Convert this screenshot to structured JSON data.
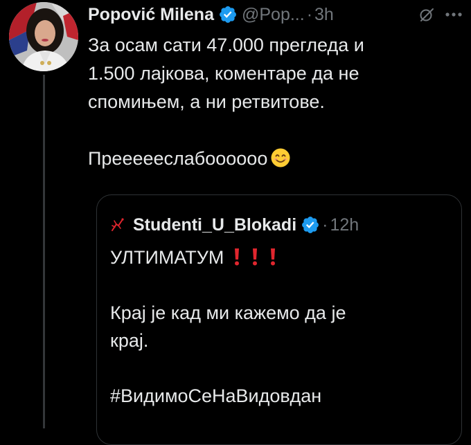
{
  "tweet": {
    "author": {
      "display_name": "Popović Milena",
      "handle": "@Pop...",
      "verified": true
    },
    "separator": "·",
    "time": "3h",
    "text_lines": [
      "За осам сати 47.000 прегледа и",
      "1.500 лајкова, коментаре да не",
      "спомињем, а ни ретвитове."
    ],
    "text_line2": "Прееееeслабоооооо",
    "emoji": "smiling-face-icon",
    "icons": {
      "verified": "verified-badge-icon",
      "grok": "grok-icon",
      "more": "more-icon"
    }
  },
  "quote": {
    "author": {
      "display_name": "Studenti_U_Blokadi",
      "verified": true,
      "avatar_icon": "red-hand-logo-icon"
    },
    "separator": "·",
    "time": "12h",
    "title": "УЛТИМАТУМ",
    "title_emoji": "red-exclamation-mark-icon",
    "title_emoji_count": 3,
    "body_lines": [
      "Крај је кад ми кажемо да је",
      "крај."
    ],
    "hashtag": "#ВидимоСеНаВидовдан"
  },
  "colors": {
    "background": "#000000",
    "text_primary": "#e7e9ea",
    "text_secondary": "#71767b",
    "verified_blue": "#1d9bf0",
    "border": "#2f3336",
    "thread_line": "#333639",
    "exclamation_red": "#e0262e"
  }
}
